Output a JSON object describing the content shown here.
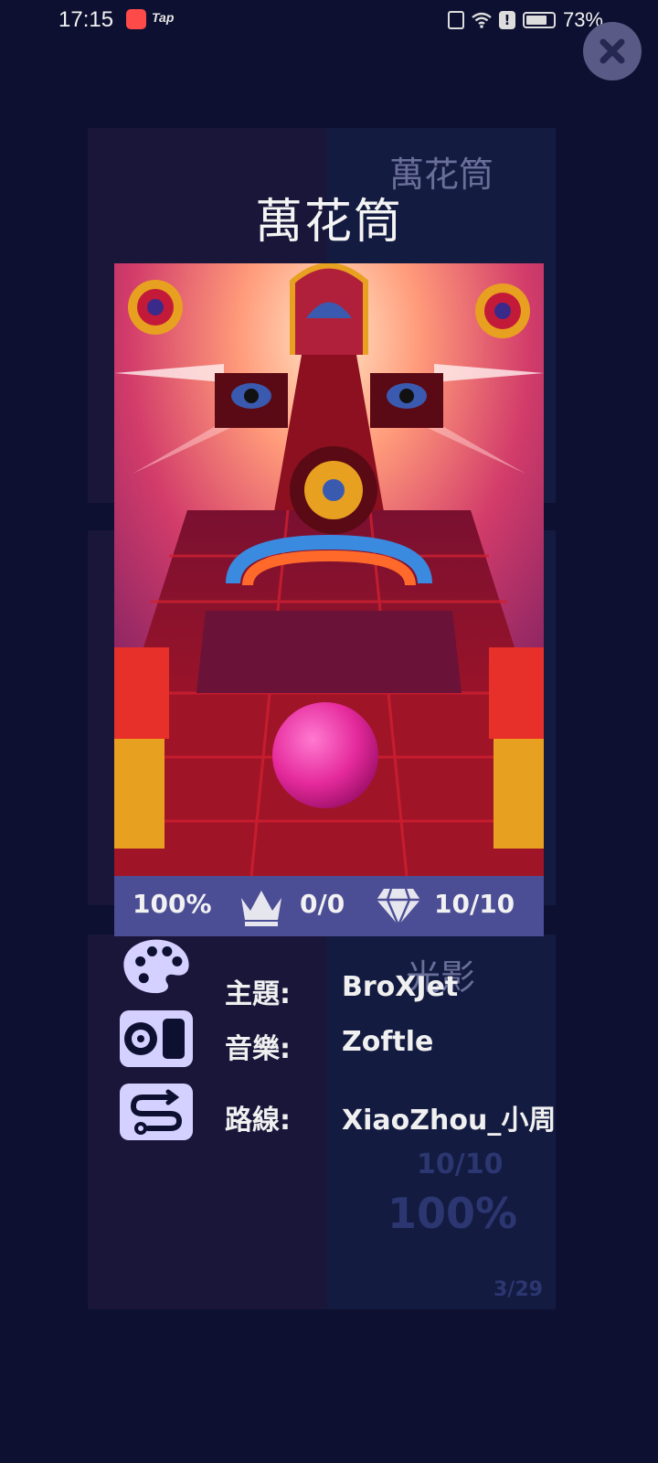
{
  "status_bar": {
    "time": "17:15",
    "tap_label": "Tap",
    "alert_mark": "!",
    "battery_percent": "73%",
    "icons": [
      "shop-app-icon",
      "tap-app-icon",
      "vibrate-icon",
      "wifi-icon",
      "alert-icon",
      "battery-icon"
    ]
  },
  "close_button": {
    "icon": "close-icon",
    "glyph": "✕"
  },
  "background_cards": {
    "top_right_title": "萬花筒",
    "bottom_right_title": "光影",
    "bottom_right_gems": "10/10",
    "bottom_right_percent": "100%",
    "bottom_right_page": "3/29"
  },
  "level": {
    "title": "萬花筒",
    "stats": {
      "progress": "100%",
      "crowns": "0/0",
      "gems": "10/10"
    },
    "info": {
      "theme_label": "主題:",
      "theme_value": "BroXJet",
      "music_label": "音樂:",
      "music_value": "Zoftle",
      "route_label": "路線:",
      "route_value": "XiaoZhou_小周"
    }
  },
  "colors": {
    "background": "#0d1030",
    "stats_bar": "#4c4e95",
    "icon_tile": "#d4d0ff",
    "ball": "#e52a9c",
    "track": "#8c1020"
  }
}
